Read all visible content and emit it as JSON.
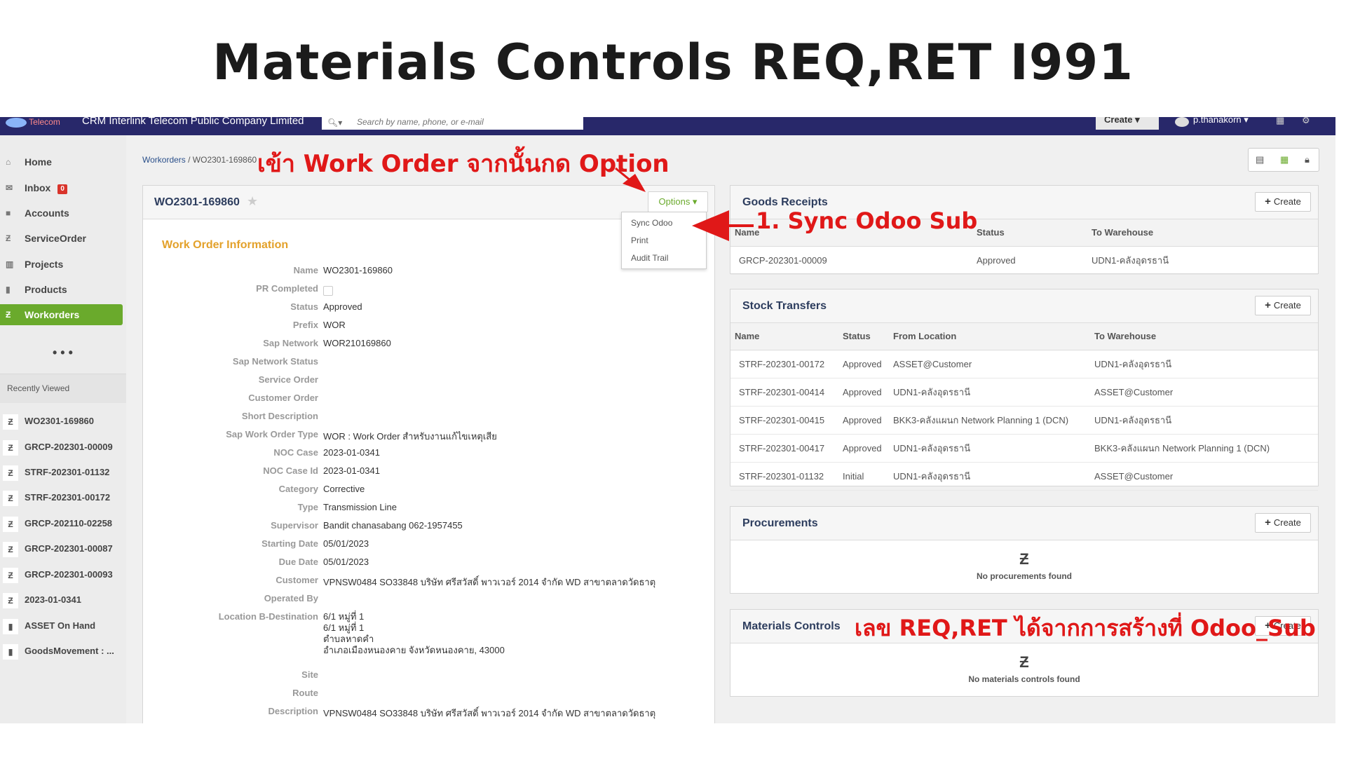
{
  "slide": {
    "title": "Materials Controls REQ,RET I991"
  },
  "topbar": {
    "logo_text": "Telecom",
    "company": "CRM Interlink Telecom Public Company Limited",
    "search_placeholder": "Search by name, phone, or e-mail",
    "create_label": "Create ▾",
    "username": "p.thanakorn ▾",
    "icons": [
      "calendar-icon",
      "gear-icon"
    ]
  },
  "sidebar": {
    "items": [
      {
        "label": "Home",
        "icon": "home-icon"
      },
      {
        "label": "Inbox",
        "icon": "envelope-icon",
        "badge": "0"
      },
      {
        "label": "Accounts",
        "icon": "folder-icon"
      },
      {
        "label": "ServiceOrder",
        "icon": "z-icon"
      },
      {
        "label": "Projects",
        "icon": "briefcase-icon"
      },
      {
        "label": "Products",
        "icon": "box-icon"
      },
      {
        "label": "Workorders",
        "icon": "z-icon",
        "active": true
      }
    ],
    "more": "• • •",
    "recent_title": "Recently Viewed",
    "recent": [
      "WO2301-169860",
      "GRCP-202301-00009",
      "STRF-202301-01132",
      "STRF-202301-00172",
      "GRCP-202110-02258",
      "GRCP-202301-00087",
      "GRCP-202301-00093",
      "2023-01-0341",
      "ASSET On Hand",
      "GoodsMovement : ..."
    ]
  },
  "breadcrumb": {
    "root": "Workorders",
    "current": " / WO2301-169860"
  },
  "workorder": {
    "id": "WO2301-169860",
    "options_label": "Options ▾",
    "menu": [
      "Sync Odoo",
      "Print",
      "Audit Trail"
    ],
    "section_title": "Work Order Information",
    "fields": [
      {
        "label": "Name",
        "value": "WO2301-169860"
      },
      {
        "label": "PR Completed",
        "value": ""
      },
      {
        "label": "Status",
        "value": "Approved"
      },
      {
        "label": "Prefix",
        "value": "WOR"
      },
      {
        "label": "Sap Network",
        "value": "WOR210169860"
      },
      {
        "label": "Sap Network Status",
        "value": ""
      },
      {
        "label": "Service Order",
        "value": ""
      },
      {
        "label": "Customer Order",
        "value": ""
      },
      {
        "label": "Short Description",
        "value": ""
      },
      {
        "label": "Sap Work Order Type",
        "value": "WOR : Work Order สำหรับงานแก้ไขเหตุเสีย"
      },
      {
        "label": "NOC Case",
        "value": "2023-01-0341"
      },
      {
        "label": "NOC Case Id",
        "value": "2023-01-0341"
      },
      {
        "label": "Category",
        "value": "Corrective"
      },
      {
        "label": "Type",
        "value": "Transmission Line"
      },
      {
        "label": "Supervisor",
        "value": "Bandit chanasabang 062-1957455"
      },
      {
        "label": "Starting Date",
        "value": "05/01/2023"
      },
      {
        "label": "Due Date",
        "value": "05/01/2023"
      },
      {
        "label": "Customer",
        "value": "VPNSW0484 SO33848 บริษัท ศรีสวัสดิ์ พาวเวอร์ 2014 จำกัด WD สาขาตลาดวัดธาตุ"
      },
      {
        "label": "Operated By",
        "value": ""
      },
      {
        "label": "Location B-Destination",
        "value": ""
      },
      {
        "label": "Site",
        "value": ""
      },
      {
        "label": "Route",
        "value": ""
      },
      {
        "label": "Description",
        "value": "VPNSW0484 SO33848 บริษัท ศรีสวัสดิ์ พาวเวอร์ 2014 จำกัด WD สาขาตลาดวัดธาตุ"
      }
    ],
    "location_lines": [
      "6/1 หมู่ที่ 1",
      "6/1 หมู่ที่ 1",
      "ตำบลหาดคำ",
      "อำเภอเมืองหนองคาย จังหวัดหนองคาย, 43000"
    ]
  },
  "goods_receipts": {
    "title": "Goods Receipts",
    "create_label": "Create",
    "headers": [
      "Name",
      "Status",
      "To Warehouse"
    ],
    "rows": [
      [
        "GRCP-202301-00009",
        "Approved",
        "UDN1-คลังอุดรธานี"
      ]
    ]
  },
  "stock_transfers": {
    "title": "Stock Transfers",
    "create_label": "Create",
    "headers": [
      "Name",
      "Status",
      "From Location",
      "To Warehouse"
    ],
    "rows": [
      [
        "STRF-202301-00172",
        "Approved",
        "ASSET@Customer",
        "UDN1-คลังอุดรธานี"
      ],
      [
        "STRF-202301-00414",
        "Approved",
        "UDN1-คลังอุดรธานี",
        "ASSET@Customer"
      ],
      [
        "STRF-202301-00415",
        "Approved",
        "BKK3-คลังแผนก Network Planning 1 (DCN)",
        "UDN1-คลังอุดรธานี"
      ],
      [
        "STRF-202301-00417",
        "Approved",
        "UDN1-คลังอุดรธานี",
        "BKK3-คลังแผนก Network Planning 1 (DCN)"
      ],
      [
        "STRF-202301-01132",
        "Initial",
        "UDN1-คลังอุดรธานี",
        "ASSET@Customer"
      ]
    ]
  },
  "procurements": {
    "title": "Procurements",
    "create_label": "Create",
    "empty": "No procurements found"
  },
  "materials_controls": {
    "title": "Materials Controls",
    "create_label": "Create",
    "empty": "No materials controls found"
  },
  "annotations": {
    "a1": "เข้า Work Order จากนั้นกด Option",
    "a2": "1. Sync Odoo Sub",
    "a3": "เลข REQ,RET ได้จากการสร้างที่ Odoo_Sub",
    "color": "#e01818"
  },
  "colors": {
    "topbar": "#28286a",
    "active": "#6aaa2c",
    "section": "#e3a12a",
    "title_text": "#2d3d5e"
  }
}
